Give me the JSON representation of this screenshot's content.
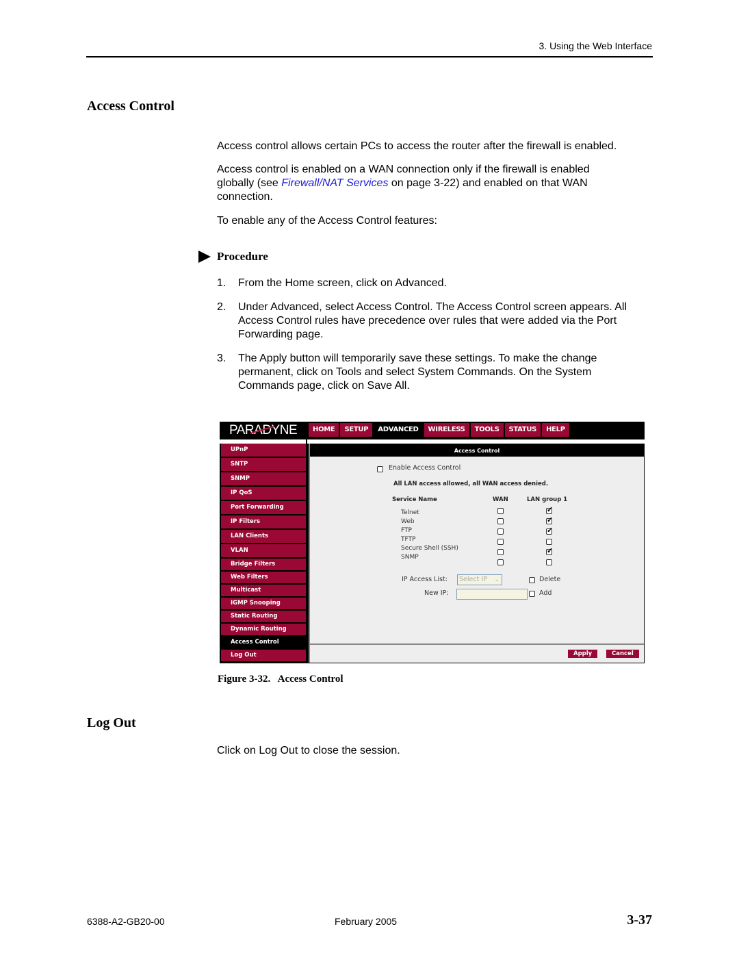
{
  "header": {
    "running_head": "3. Using the Web Interface"
  },
  "section1": {
    "title": "Access Control",
    "para1": "Access control allows certain PCs to access the router after the firewall is enabled.",
    "para2_before": "Access control is enabled on a WAN connection only if the firewall is enabled globally (see ",
    "para2_link": "Firewall/NAT Services",
    "para2_after": " on page 3-22) and enabled on that WAN connection.",
    "para3": "To enable any of the Access Control features:",
    "procedure_label": "Procedure",
    "steps": [
      {
        "num": "1.",
        "text": "From the Home screen, click on Advanced."
      },
      {
        "num": "2.",
        "text": "Under Advanced, select Access Control. The Access Control screen appears. All Access Control rules have precedence over rules that were added via the Port Forwarding page."
      },
      {
        "num": "3.",
        "text": "The Apply button will temporarily save these settings. To make the change permanent, click on Tools and select System Commands. On the System Commands page, click on Save All."
      }
    ]
  },
  "screenshot": {
    "logo": "PARADYNE",
    "nav_tabs": [
      {
        "label": "HOME",
        "active": false
      },
      {
        "label": "SETUP",
        "active": false
      },
      {
        "label": "ADVANCED",
        "active": true
      },
      {
        "label": "WIRELESS",
        "active": false
      },
      {
        "label": "TOOLS",
        "active": false
      },
      {
        "label": "STATUS",
        "active": false
      },
      {
        "label": "HELP",
        "active": false
      }
    ],
    "sidebar": [
      {
        "label": "UPnP",
        "active": false
      },
      {
        "label": "SNTP",
        "active": false
      },
      {
        "label": "SNMP",
        "active": false
      },
      {
        "label": "IP QoS",
        "active": false
      },
      {
        "label": "Port Forwarding",
        "active": false
      },
      {
        "label": "IP Filters",
        "active": false
      },
      {
        "label": "LAN Clients",
        "active": false
      },
      {
        "label": "VLAN",
        "active": false
      },
      {
        "label": "Bridge Filters",
        "active": false
      },
      {
        "label": "Web Filters",
        "active": false
      },
      {
        "label": "Multicast",
        "active": false
      },
      {
        "label": "IGMP Snooping",
        "active": false
      },
      {
        "label": "Static Routing",
        "active": false
      },
      {
        "label": "Dynamic Routing",
        "active": false
      },
      {
        "label": "Access Control",
        "active": true
      },
      {
        "label": "Log Out",
        "active": false
      }
    ],
    "panel_title": "Access Control",
    "enable_label": "Enable Access Control",
    "enable_checked": false,
    "status_message": "All LAN access allowed, all WAN access denied.",
    "columns": {
      "service": "Service Name",
      "wan": "WAN",
      "lan": "LAN group 1"
    },
    "services": [
      {
        "name": "Telnet",
        "wan": false,
        "lan": true
      },
      {
        "name": "Web",
        "wan": false,
        "lan": true
      },
      {
        "name": "FTP",
        "wan": false,
        "lan": true
      },
      {
        "name": "TFTP",
        "wan": false,
        "lan": false
      },
      {
        "name": "Secure Shell (SSH)",
        "wan": false,
        "lan": true
      },
      {
        "name": "SNMP",
        "wan": false,
        "lan": false
      }
    ],
    "ip_access_list_label": "IP Access List:",
    "ip_access_list_value": "Select IP",
    "delete_label": "Delete",
    "new_ip_label": "New IP:",
    "new_ip_value": "",
    "add_label": "Add",
    "apply_label": "Apply",
    "cancel_label": "Cancel",
    "colors": {
      "brand": "#9a0836",
      "active": "#000000",
      "panel_bg": "#eeeeee"
    }
  },
  "figure_caption": "Figure 3-32.   Access Control",
  "section2": {
    "title": "Log Out",
    "para": "Click on Log Out to close the session."
  },
  "footer": {
    "doc_number": "6388-A2-GB20-00",
    "date": "February 2005",
    "page": "3-37"
  }
}
